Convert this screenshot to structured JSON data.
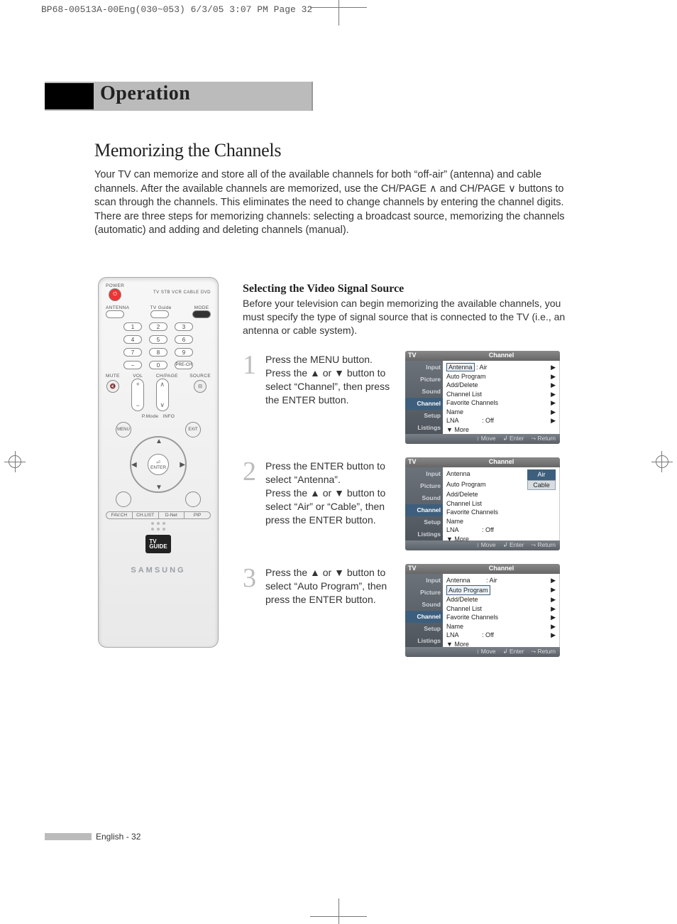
{
  "prepress": "BP68-00513A-00Eng(030~053)  6/3/05  3:07 PM  Page 32",
  "section_title": "Operation",
  "page_title": "Memorizing the Channels",
  "intro": "Your TV can memorize and store all of the available channels for both “off-air” (antenna) and cable channels. After the available channels are memorized, use the CH/PAGE ∧ and CH/PAGE ∨ buttons to scan through the channels. This eliminates the need to change channels by entering the channel digits. There are three steps for memorizing channels: selecting a broadcast source, memorizing the channels (automatic) and adding and deleting channels (manual).",
  "sub_heading": "Selecting the Video Signal Source",
  "sub_text": "Before your television can begin memorizing the available channels, you must specify the type of signal source that is connected to the TV (i.e., an antenna or cable system).",
  "steps": {
    "s1": {
      "n": "1",
      "t": "Press the MENU button.\nPress the ▲ or ▼ button to select “Channel”, then press the ENTER button."
    },
    "s2": {
      "n": "2",
      "t": "Press the ENTER button to select “Antenna”.\nPress the ▲ or ▼ button to select “Air” or “Cable”, then press the ENTER button."
    },
    "s3": {
      "n": "3",
      "t": "Press the ▲ or ▼ button to select “Auto Program”, then press the ENTER button."
    }
  },
  "panel": {
    "tv": "TV",
    "channel_hdr": "Channel",
    "sidebar": [
      "Input",
      "Picture",
      "Sound",
      "Channel",
      "Setup",
      "Listings"
    ],
    "rows": {
      "antenna": "Antenna",
      "air": ": Air",
      "auto": "Auto Program",
      "add": "Add/Delete",
      "list": "Channel List",
      "fav": "Favorite Channels",
      "name": "Name",
      "lna": "LNA",
      "off": ": Off",
      "more": "▼ More"
    },
    "options": {
      "air": "Air",
      "cable": "Cable"
    },
    "footer": {
      "move": "↕ Move",
      "enter": "↲ Enter",
      "return": "⤳ Return"
    }
  },
  "remote": {
    "power": "POWER",
    "modes": "TV  STB  VCR  CABLE  DVD",
    "row2": {
      "antenna": "ANTENNA",
      "tvguide": "TV Guide",
      "mode": "MODE"
    },
    "nums": [
      "1",
      "2",
      "3",
      "4",
      "5",
      "6",
      "7",
      "8",
      "9",
      "−",
      "0",
      "PRE-CH"
    ],
    "vol": "VOL",
    "chpage": "CH/PAGE",
    "mute": "MUTE",
    "source": "SOURCE",
    "pmode": "P.Mode",
    "info": "INFO",
    "menu": "MENU",
    "exit": "EXIT",
    "enter": "ENTER",
    "bottom": [
      "FAV.CH",
      "CH.LIST",
      "D-Net",
      "PIP"
    ],
    "brand": "SAMSUNG",
    "tvg": "TV\nGUIDE"
  },
  "footer_text": "English - 32"
}
